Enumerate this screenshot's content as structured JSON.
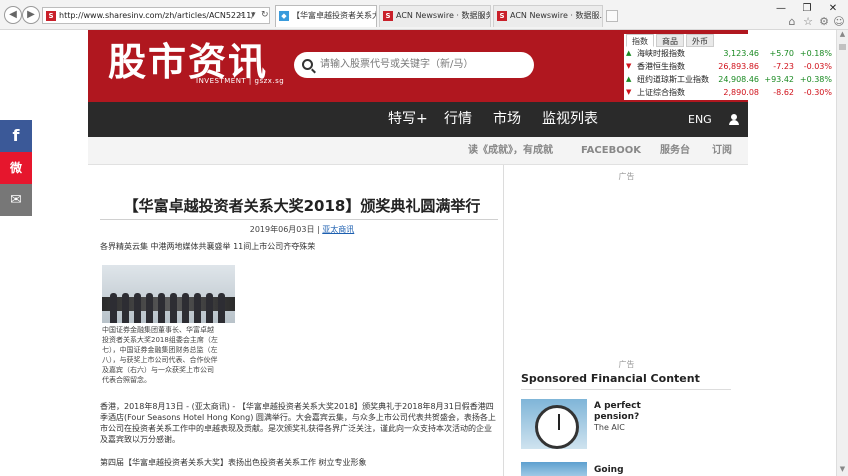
{
  "browser": {
    "url": "http://www.sharesinv.com/zh/articles/ACN52211/",
    "tabs": [
      {
        "label": "【华富卓越投资者关系大奖20...",
        "active": true
      },
      {
        "label": "ACN Newswire · 数据服务...",
        "active": false
      },
      {
        "label": "ACN Newswire · 数据服...",
        "active": false
      }
    ],
    "favicon_letter": "S"
  },
  "site": {
    "logo": "股市资讯",
    "logo_sub": "INVESTMENT | gszx.sg",
    "search_placeholder": "请输入股票代号或关键字（新/马）"
  },
  "market": {
    "tabs": [
      "指数",
      "商品",
      "外币"
    ],
    "rows": [
      {
        "dir": "up",
        "name": "海峡时报指数",
        "value": "3,123.46",
        "change": "+5.70",
        "pct": "+0.18%"
      },
      {
        "dir": "down",
        "name": "香港恒生指数",
        "value": "26,893.86",
        "change": "-7.23",
        "pct": "-0.03%"
      },
      {
        "dir": "up",
        "name": "纽约道琼斯工业指数",
        "value": "24,908.46",
        "change": "+93.42",
        "pct": "+0.38%"
      },
      {
        "dir": "down",
        "name": "上证综合指数",
        "value": "2,890.08",
        "change": "-8.62",
        "pct": "-0.30%"
      }
    ]
  },
  "nav": {
    "items": [
      "特写+",
      "行情",
      "市场",
      "监视列表"
    ],
    "lang": "ENG"
  },
  "subnav": {
    "items": [
      "读《成就》，有成就",
      "FACEBOOK",
      "服务台",
      "订阅"
    ]
  },
  "social": {
    "facebook": "f",
    "weibo": "微",
    "email": "✉"
  },
  "article": {
    "title": "【华富卓越投资者关系大奖2018】颁奖典礼圆满举行",
    "date": "2019年06月03日 | ",
    "source": "亚太商讯",
    "lead": "各界精英云集 中港两地媒体共襄盛举 11间上市公司齐夺殊荣",
    "caption": "中国证券金融集团董事长、华富卓越投资者关系大奖2018组委会主席（左七），中国证券金融集团财务总监（左八），与获奖上市公司代表、合作伙伴及嘉宾（右六）与一众获奖上市公司代表合照留念。",
    "body": "香港，2018年8月13日 - (亚太商讯) - 【华富卓越投资者关系大奖2018】颁奖典礼于2018年8月31日假香港四季酒店(Four Seasons Hotel Hong Kong) 圆满举行。大会嘉宾云集，与众多上市公司代表共贺盛会，表扬各上市公司在投资者关系工作中的卓越表现及贡献。是次颁奖礼获得各界广泛关注，谨此向一众支持本次活动的企业及嘉宾致以万分感谢。",
    "sub": "第四届【华富卓越投资者关系大奖】表扬出色投资者关系工作 树立专业形象"
  },
  "sidebar": {
    "ad_label": "广告",
    "sponsored_title": "Sponsored Financial Content",
    "items": [
      {
        "title": "A perfect pension?",
        "source": "The AIC"
      },
      {
        "title": "Going",
        "source": ""
      }
    ]
  }
}
